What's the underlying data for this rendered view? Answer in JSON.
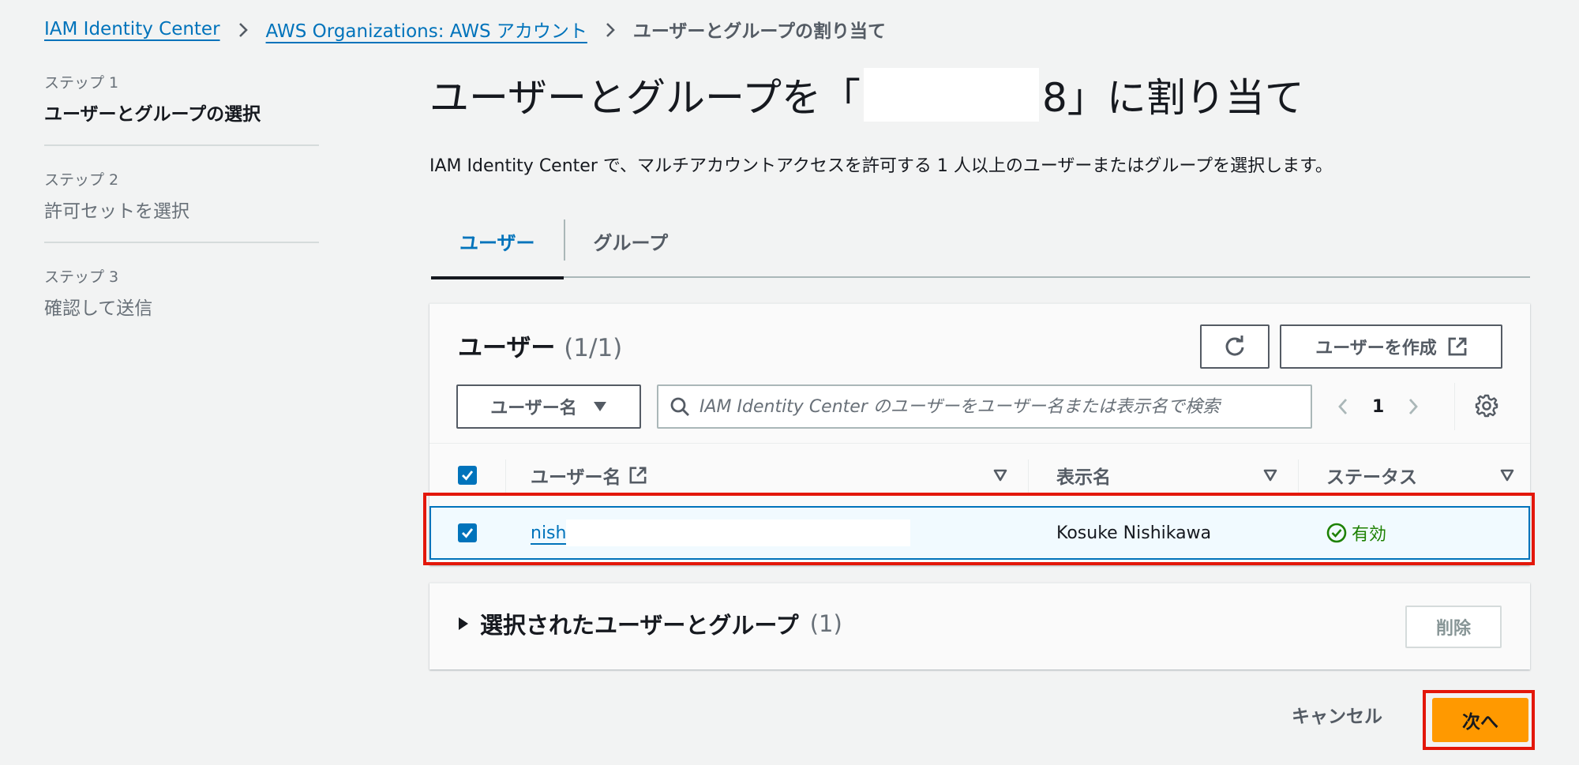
{
  "breadcrumb": {
    "items": [
      {
        "label": "IAM Identity Center",
        "link": true
      },
      {
        "label": "AWS Organizations: AWS アカウント",
        "link": true
      },
      {
        "label": "ユーザーとグループの割り当て",
        "link": false
      }
    ]
  },
  "steps": [
    {
      "number": "ステップ 1",
      "title": "ユーザーとグループの選択",
      "active": true
    },
    {
      "number": "ステップ 2",
      "title": "許可セットを選択",
      "active": false
    },
    {
      "number": "ステップ 3",
      "title": "確認して送信",
      "active": false
    }
  ],
  "page": {
    "title_prefix": "ユーザーとグループを「",
    "title_suffix": "8」に割り当て",
    "description": "IAM Identity Center で、マルチアカウントアクセスを許可する 1 人以上のユーザーまたはグループを選択します。"
  },
  "tabs": [
    {
      "label": "ユーザー",
      "active": true
    },
    {
      "label": "グループ",
      "active": false
    }
  ],
  "users_panel": {
    "title": "ユーザー",
    "count": "(1/1)",
    "refresh_icon": "refresh-icon",
    "create_button": "ユーザーを作成",
    "filter_property": "ユーザー名",
    "search_placeholder": "IAM Identity Center のユーザーをユーザー名または表示名で検索",
    "search_value": "",
    "pagination": {
      "current_page": "1"
    },
    "columns": [
      "ユーザー名",
      "表示名",
      "ステータス"
    ],
    "rows": [
      {
        "selected": true,
        "username_visible": "nish",
        "display_name": "Kosuke Nishikawa",
        "status": "有効"
      }
    ],
    "colors": {
      "status_ok": "#1d8102",
      "link": "#0073bb"
    }
  },
  "selected_panel": {
    "title": "選択されたユーザーとグループ",
    "count": "(1)",
    "remove_button": "削除"
  },
  "footer": {
    "cancel": "キャンセル",
    "next": "次へ",
    "primary_color": "#ff9900"
  }
}
